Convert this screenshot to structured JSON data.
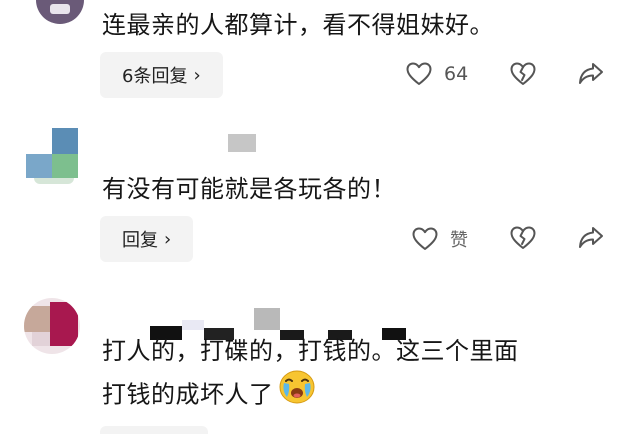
{
  "comments": [
    {
      "text": "连最亲的人都算计，看不得姐妹好。",
      "reply_label": "6条回复",
      "like_count": "64"
    },
    {
      "text": "有没有可能就是各玩各的！",
      "reply_label": "回复",
      "like_count": "赞"
    },
    {
      "text_line1": "打人的，打碟的，打钱的。这三个里面",
      "text_line2": "打钱的成坏人了",
      "emoji": "crying-face-icon"
    }
  ],
  "colors": {
    "text": "#161616",
    "reply_bg": "#f3f3f3",
    "icon": "#555555"
  }
}
